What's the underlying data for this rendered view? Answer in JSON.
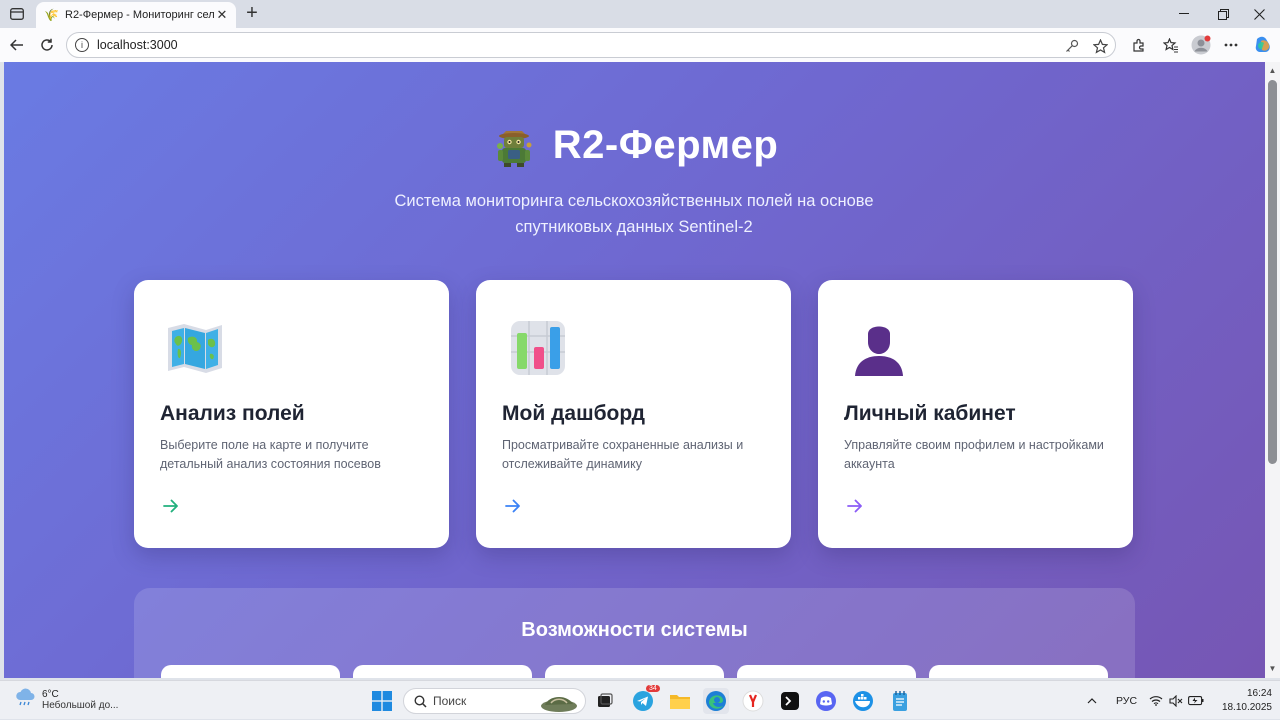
{
  "browser": {
    "tab_title": "R2-Фермер - Мониторинг сельс",
    "url": "localhost:3000"
  },
  "page": {
    "title": "R2-Фермер",
    "subtitle_line1": "Система мониторинга сельскохозяйственных полей на основе",
    "subtitle_line2": "спутниковых данных Sentinel-2",
    "cards": [
      {
        "title": "Анализ полей",
        "desc_line1": "Выберите поле на карте и получите",
        "desc_line2": "детальный анализ состояния посевов",
        "icon": "world-map-icon",
        "arrow_color": "#22b07d"
      },
      {
        "title": "Мой дашборд",
        "desc_line1": "Просматривайте сохраненные анализы и",
        "desc_line2": "отслеживайте динамику",
        "icon": "bar-chart-icon",
        "arrow_color": "#3b82f6"
      },
      {
        "title": "Личный кабинет",
        "desc_line1": "Управляйте своим профилем и настройками",
        "desc_line2": "аккаунта",
        "icon": "user-silhouette-icon",
        "arrow_color": "#8b5cf6"
      }
    ],
    "features_title": "Возможности системы"
  },
  "taskbar": {
    "temperature": "6°C",
    "weather_desc": "Небольшой до...",
    "search_placeholder": "Поиск",
    "telegram_badge": "34",
    "language": "РУС",
    "time": "16:24",
    "date": "18.10.2025"
  },
  "colors": {
    "gradient_start": "#6a7be3",
    "gradient_end": "#7656b4",
    "card_bg": "#ffffff"
  }
}
